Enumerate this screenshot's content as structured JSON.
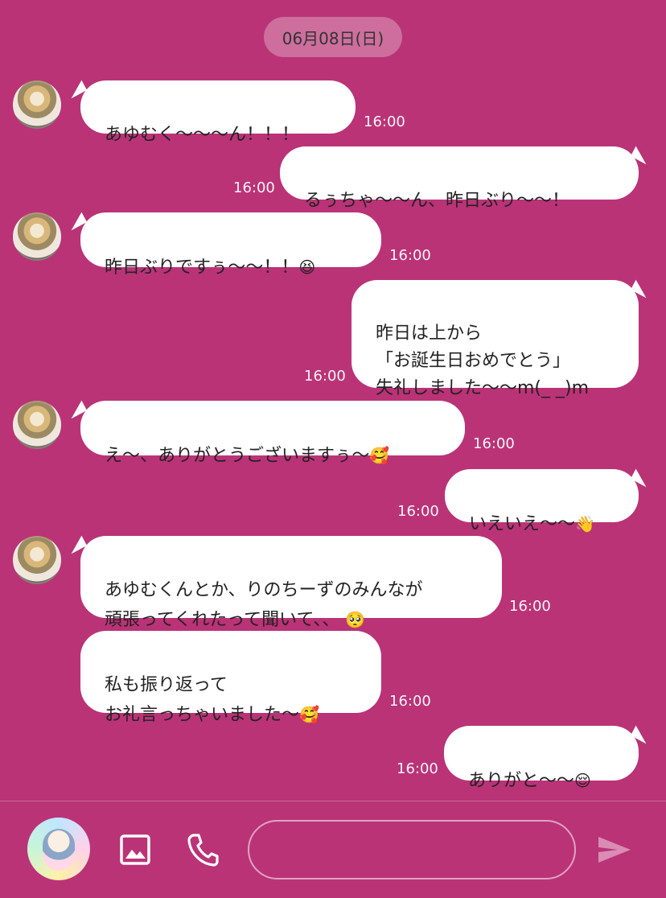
{
  "date_label": "06月08日(日)",
  "messages": [
    {
      "side": "left",
      "text": "あゆむく〜〜〜ん！！！",
      "time": "16:00"
    },
    {
      "side": "right",
      "text": "るぅちゃ〜〜ん、昨日ぶり〜〜！",
      "time": "16:00"
    },
    {
      "side": "left",
      "text": "昨日ぶりですぅ〜〜！！",
      "emoji": "😆",
      "time": "16:00"
    },
    {
      "side": "right",
      "text": "昨日は上から\n「お誕生日おめでとう」\n失礼しました〜〜m(_ _)m",
      "time": "16:00"
    },
    {
      "side": "left",
      "text": "え〜、ありがとうございますぅ〜",
      "emoji": "🥰",
      "time": "16:00"
    },
    {
      "side": "right",
      "text": "いえいえ〜〜",
      "emoji": "👋",
      "time": "16:00"
    },
    {
      "side": "left",
      "text": "あゆむくんとか、りのちーずのみんなが\n頑張ってくれたって聞いて、、",
      "emoji": "🥺",
      "time": "16:00"
    },
    {
      "side": "left",
      "text": "私も振り返って\nお礼言っちゃいました〜",
      "emoji": "🥰",
      "time": "16:00"
    },
    {
      "side": "right",
      "text": "ありがと〜〜",
      "emoji": "😌",
      "time": "16:00"
    }
  ],
  "composer": {
    "placeholder": "",
    "value": ""
  },
  "icons": {
    "image": "image-icon",
    "phone": "phone-icon",
    "send": "send-icon"
  },
  "colors": {
    "background": "#BA3377",
    "bubble": "#FFFFFF",
    "date_pill": "#CD6E9D",
    "send_icon": "#D98CB4"
  }
}
